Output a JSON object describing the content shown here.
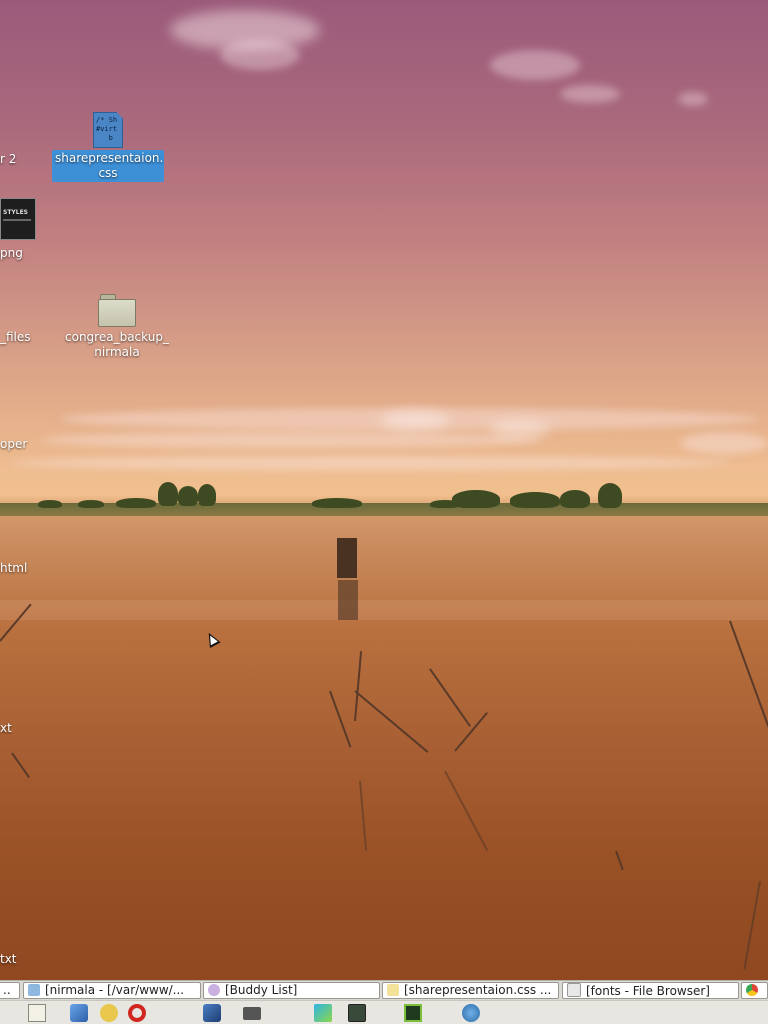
{
  "desktop": {
    "icons": [
      {
        "label": "sharepresentaion.\ncss",
        "file_preview": "/* Sh\n#virt\n   b",
        "selected": true
      },
      {
        "label": "congrea_backup_\nnirmala"
      }
    ],
    "clipped_labels": [
      "r 2",
      "png",
      "_files",
      "oper",
      "html",
      "xt",
      "txt"
    ],
    "thumbnail_text": "STYLES"
  },
  "taskbar": {
    "tasks": [
      {
        "label": "..",
        "icon": "app-icon"
      },
      {
        "label": "[nirmala - [/var/www/...",
        "icon": "editor-icon"
      },
      {
        "label": "[Buddy List]",
        "icon": "pidgin-icon"
      },
      {
        "label": "[sharepresentaion.css ...",
        "icon": "text-editor-icon"
      },
      {
        "label": "[fonts - File Browser]",
        "icon": "file-browser-icon"
      },
      {
        "label": "",
        "icon": "chrome-icon"
      }
    ]
  },
  "launcher": {
    "items": [
      "notepad-icon",
      "cube-icon",
      "pidgin-icon",
      "opera-icon",
      "virtualbox-icon",
      "camera-icon",
      "webstorm-icon",
      "calculator-icon",
      "system-monitor-icon",
      "globe-icon"
    ]
  },
  "colors": {
    "selection": "#3d8fd6",
    "taskbar_bg": "#dcdad5"
  }
}
